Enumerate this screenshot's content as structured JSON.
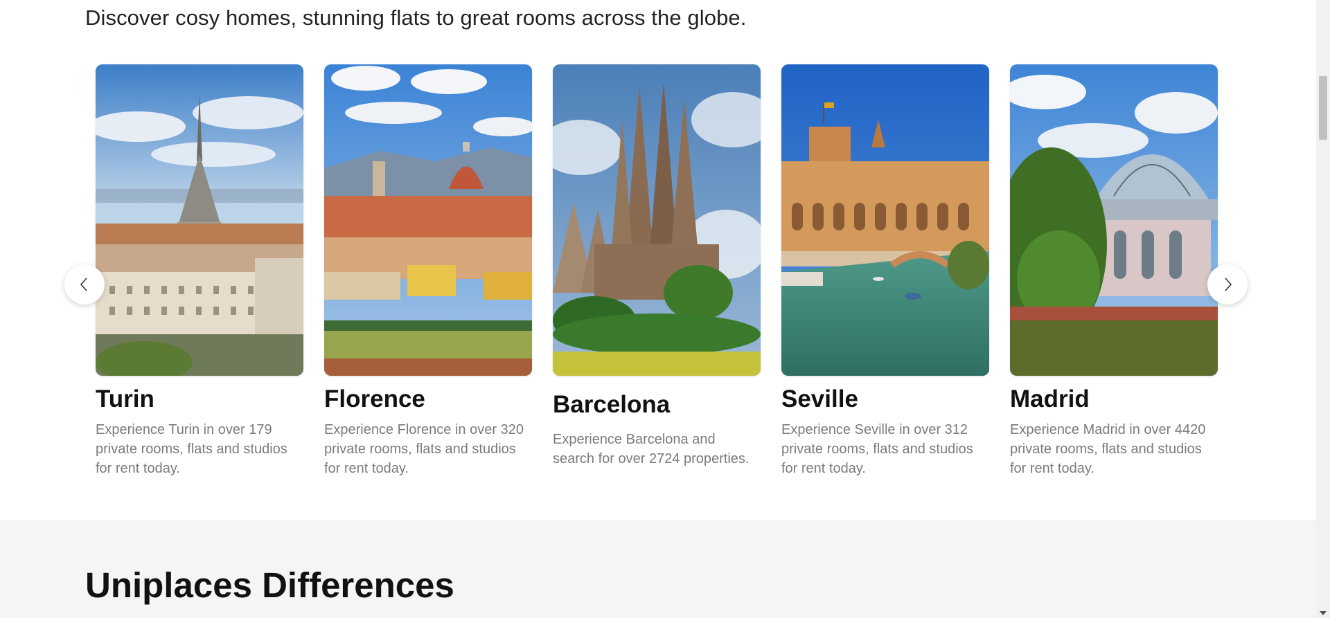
{
  "intro": "Discover cosy homes, stunning flats to great rooms across the globe.",
  "cities": [
    {
      "name": "Turin",
      "desc": "Experience Turin in over 179 private rooms, flats and studios for rent today."
    },
    {
      "name": "Florence",
      "desc": "Experience Florence in over 320 private rooms, flats and studios for rent today."
    },
    {
      "name": "Barcelona",
      "desc": "Experience Barcelona and search for over 2724 properties."
    },
    {
      "name": "Seville",
      "desc": "Experience Seville in over 312 private rooms, flats and studios for rent today."
    },
    {
      "name": "Madrid",
      "desc": "Experience Madrid in over 4420 private rooms, flats and studios for rent today."
    }
  ],
  "nav": {
    "prev_icon": "chevron-left-icon",
    "next_icon": "chevron-right-icon"
  },
  "section_title": "Uniplaces Differences",
  "colors": {
    "sky": "#4a8fd8",
    "text_muted": "#7b7b7b",
    "section_bg": "#f5f5f5"
  }
}
